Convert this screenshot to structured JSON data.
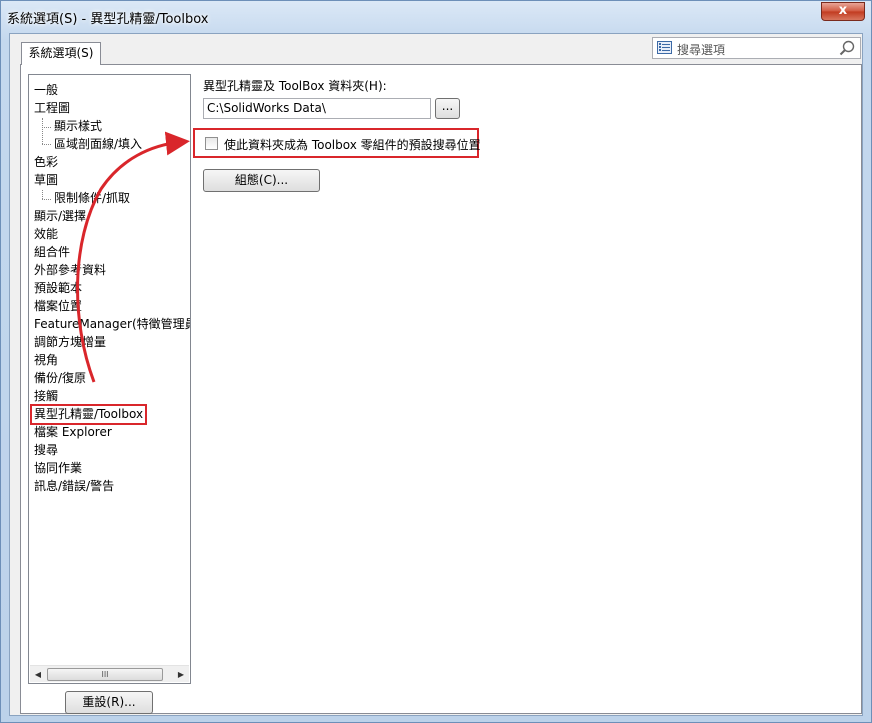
{
  "window": {
    "title": "系統選項(S) - 異型孔精靈/Toolbox",
    "close_label": "x"
  },
  "tab": {
    "label": "系統選項(S)"
  },
  "search": {
    "placeholder": "搜尋選項"
  },
  "tree": {
    "items": [
      {
        "label": "一般",
        "level": 0
      },
      {
        "label": "工程圖",
        "level": 0
      },
      {
        "label": "顯示樣式",
        "level": 1
      },
      {
        "label": "區域剖面線/填入",
        "level": 1
      },
      {
        "label": "色彩",
        "level": 0
      },
      {
        "label": "草圖",
        "level": 0
      },
      {
        "label": "限制條件/抓取",
        "level": 1
      },
      {
        "label": "顯示/選擇",
        "level": 0
      },
      {
        "label": "效能",
        "level": 0
      },
      {
        "label": "組合件",
        "level": 0
      },
      {
        "label": "外部參考資料",
        "level": 0
      },
      {
        "label": "預設範本",
        "level": 0
      },
      {
        "label": "檔案位置",
        "level": 0
      },
      {
        "label": "FeatureManager(特徵管理員",
        "level": 0
      },
      {
        "label": "調節方塊增量",
        "level": 0
      },
      {
        "label": "視角",
        "level": 0
      },
      {
        "label": "備份/復原",
        "level": 0
      },
      {
        "label": "接觸",
        "level": 0
      },
      {
        "label": "異型孔精靈/Toolbox",
        "level": 0,
        "selected": true
      },
      {
        "label": "檔案 Explorer",
        "level": 0
      },
      {
        "label": "搜尋",
        "level": 0
      },
      {
        "label": "協同作業",
        "level": 0
      },
      {
        "label": "訊息/錯誤/警告",
        "level": 0
      }
    ],
    "scroll_left": "◀",
    "scroll_right": "▶",
    "scroll_thumb_grip": "III"
  },
  "reset_button": "重設(R)...",
  "main": {
    "folder_label": "異型孔精靈及 ToolBox 資料夾(H):",
    "folder_path": "C:\\SolidWorks Data\\",
    "browse_label": "...",
    "checkbox_label": "使此資料夾成為 Toolbox 零組件的預設搜尋位置",
    "checkbox_checked": false,
    "config_button": "組態(C)..."
  },
  "colors": {
    "highlight": "#d9262b",
    "title_bar": "#c4d8ee"
  }
}
